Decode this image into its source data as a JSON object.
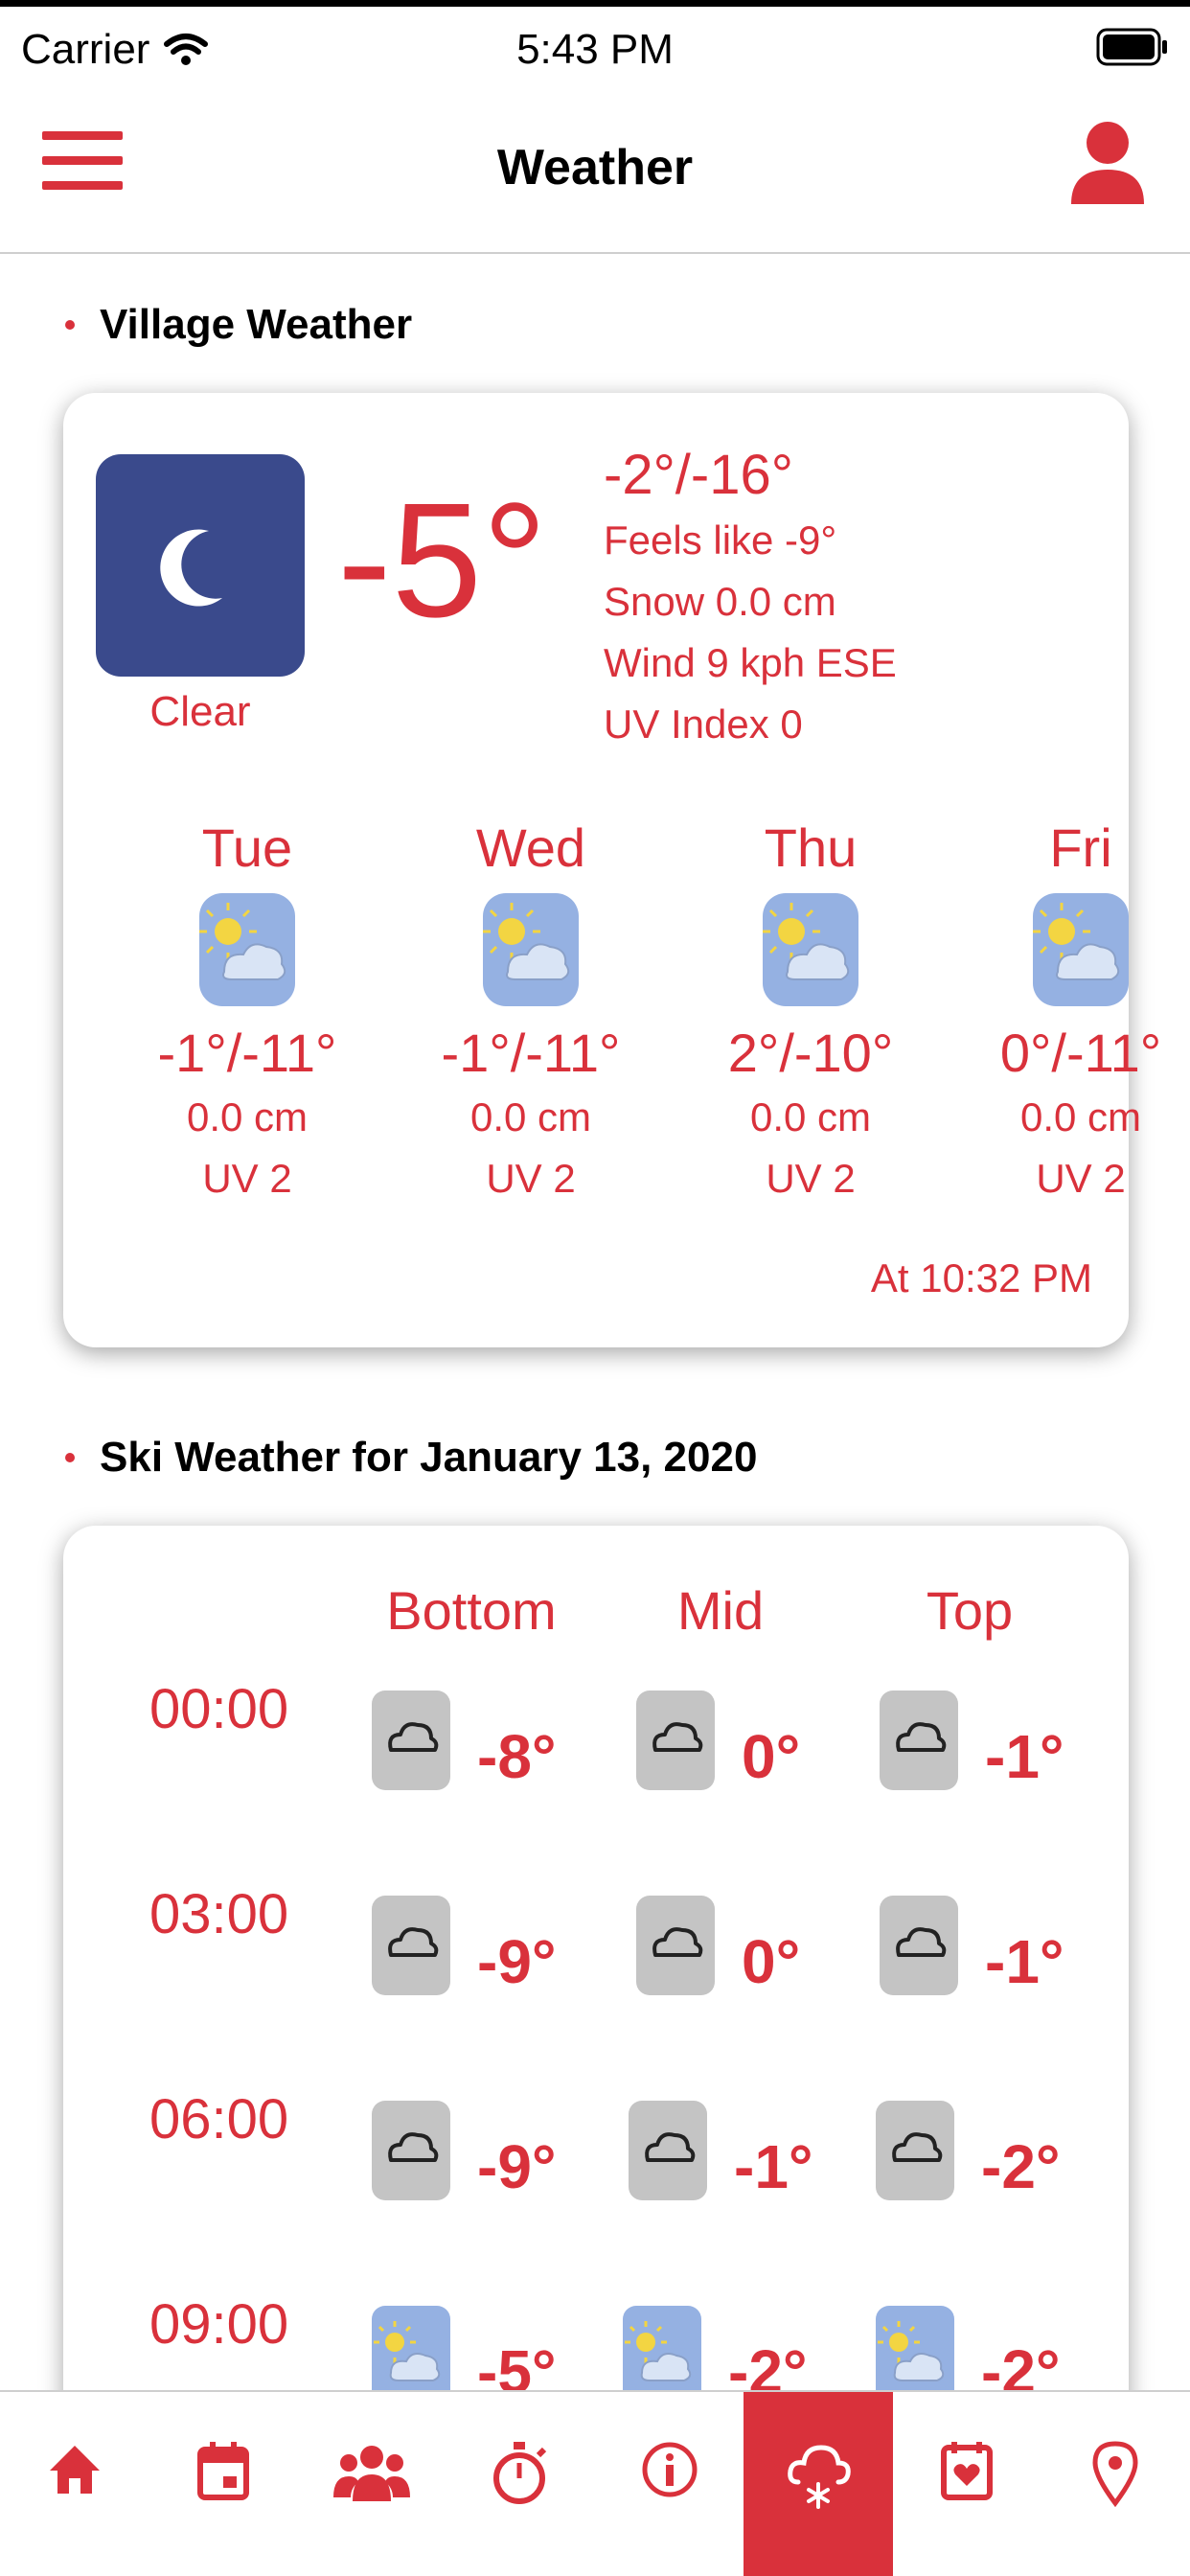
{
  "status_bar": {
    "carrier": "Carrier",
    "time": "5:43 PM"
  },
  "header": {
    "title": "Weather"
  },
  "village": {
    "section_title": "Village Weather",
    "current": {
      "icon": "moon-icon",
      "condition": "Clear",
      "temperature": "-5°",
      "high_low": "-2°/-16°",
      "feels_like": "Feels like -9°",
      "snow": "Snow 0.0 cm",
      "wind": "Wind 9 kph ESE",
      "uv": "UV Index 0"
    },
    "forecast": [
      {
        "day": "Tue",
        "icon": "partly-cloudy-icon",
        "temp": "-1°/-11°",
        "snow": "0.0 cm",
        "uv": "UV 2"
      },
      {
        "day": "Wed",
        "icon": "partly-cloudy-icon",
        "temp": "-1°/-11°",
        "snow": "0.0 cm",
        "uv": "UV 2"
      },
      {
        "day": "Thu",
        "icon": "partly-cloudy-icon",
        "temp": "2°/-10°",
        "snow": "0.0 cm",
        "uv": "UV 2"
      },
      {
        "day": "Fri",
        "icon": "partly-cloudy-icon",
        "temp": "0°/-11°",
        "snow": "0.0 cm",
        "uv": "UV 2"
      }
    ],
    "updated": "At  10:32 PM"
  },
  "ski": {
    "section_title": "Ski Weather for  January 13, 2020",
    "columns": [
      "Bottom",
      "Mid",
      "Top"
    ],
    "rows": [
      {
        "time": "00:00",
        "cells": [
          {
            "icon": "cloud-icon",
            "temp": "-8°"
          },
          {
            "icon": "cloud-icon",
            "temp": "0°"
          },
          {
            "icon": "cloud-icon",
            "temp": "-1°"
          }
        ]
      },
      {
        "time": "03:00",
        "cells": [
          {
            "icon": "cloud-icon",
            "temp": "-9°"
          },
          {
            "icon": "cloud-icon",
            "temp": "0°"
          },
          {
            "icon": "cloud-icon",
            "temp": "-1°"
          }
        ]
      },
      {
        "time": "06:00",
        "cells": [
          {
            "icon": "cloud-icon",
            "temp": "-9°"
          },
          {
            "icon": "cloud-icon",
            "temp": "-1°"
          },
          {
            "icon": "cloud-icon",
            "temp": "-2°"
          }
        ]
      },
      {
        "time": "09:00",
        "cells": [
          {
            "icon": "partly-cloudy-icon",
            "temp": "-5°"
          },
          {
            "icon": "partly-cloudy-icon",
            "temp": "-2°"
          },
          {
            "icon": "partly-cloudy-icon",
            "temp": "-2°"
          }
        ]
      }
    ]
  },
  "tabs": [
    {
      "icon": "home-icon",
      "active": false
    },
    {
      "icon": "calendar-icon",
      "active": false
    },
    {
      "icon": "group-icon",
      "active": false
    },
    {
      "icon": "stopwatch-icon",
      "active": false
    },
    {
      "icon": "info-icon",
      "active": false
    },
    {
      "icon": "snow-cloud-icon",
      "active": true
    },
    {
      "icon": "pass-card-icon",
      "active": false
    },
    {
      "icon": "location-pin-icon",
      "active": false
    }
  ],
  "colors": {
    "accent": "#d9313b",
    "moon_bg": "#3a4a8c",
    "partly_cloudy_bg": "#95b1e2",
    "cloud_bg": "#c4c4c4"
  }
}
